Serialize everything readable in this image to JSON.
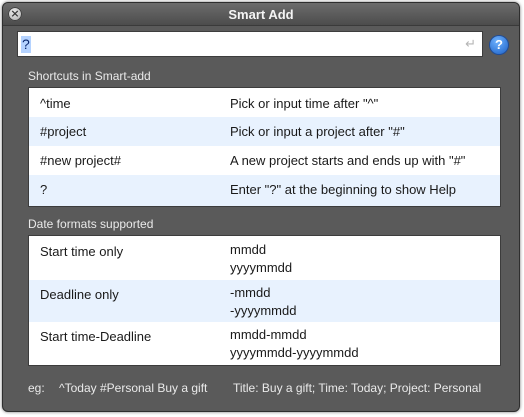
{
  "window": {
    "title": "Smart Add"
  },
  "search": {
    "value": "?"
  },
  "shortcuts": {
    "header": "Shortcuts in Smart-add",
    "rows": [
      {
        "key": "^time",
        "desc": "Pick or input time after \"^\""
      },
      {
        "key": "#project",
        "desc": "Pick or input a project after \"#\""
      },
      {
        "key": "#new project#",
        "desc": "A new project starts and ends up with \"#\""
      },
      {
        "key": "?",
        "desc": "Enter \"?\" at the beginning to show Help"
      }
    ]
  },
  "date_formats": {
    "header": "Date formats supported",
    "rows": [
      {
        "key": "Start time only",
        "line1": "mmdd",
        "line2": "yyyymmdd"
      },
      {
        "key": "Deadline only",
        "line1": "-mmdd",
        "line2": "-yyyymmdd"
      },
      {
        "key": "Start time-Deadline",
        "line1": "mmdd-mmdd",
        "line2": "yyyymmdd-yyyymmdd"
      }
    ]
  },
  "footer": {
    "eg_label": "eg:",
    "example": "^Today #Personal Buy a gift",
    "result": "Title: Buy a gift; Time: Today; Project: Personal"
  },
  "icons": {
    "close": "close-icon",
    "return": "return-icon",
    "help": "help-icon"
  }
}
